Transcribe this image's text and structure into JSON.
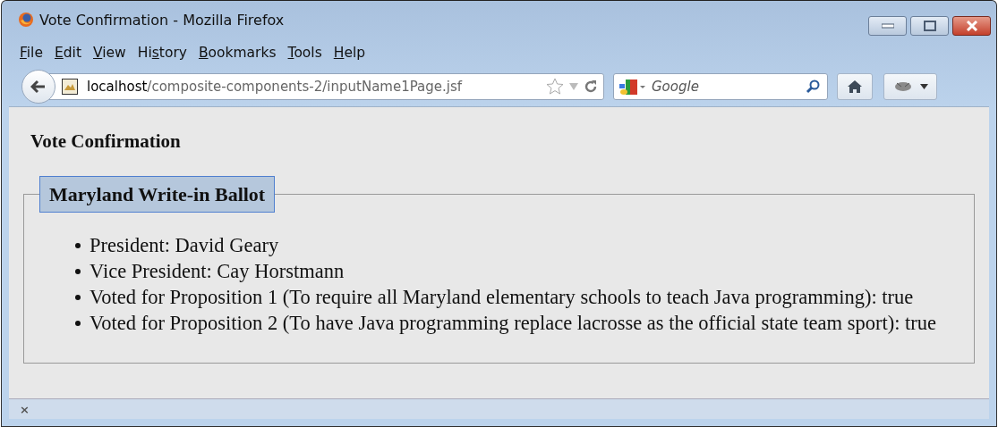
{
  "window": {
    "title": "Vote Confirmation - Mozilla Firefox"
  },
  "menu": [
    {
      "key": "F",
      "after": "ile"
    },
    {
      "key": "E",
      "after": "dit"
    },
    {
      "key": "V",
      "after": "iew"
    },
    {
      "before": "Hi",
      "key": "s",
      "after": "tory"
    },
    {
      "key": "B",
      "after": "ookmarks"
    },
    {
      "key": "T",
      "after": "ools"
    },
    {
      "key": "H",
      "after": "elp"
    }
  ],
  "address": {
    "host": "localhost",
    "path": "/composite-components-2/inputName1Page.jsf"
  },
  "search": {
    "placeholder": "Google"
  },
  "page": {
    "heading": "Vote Confirmation",
    "legend": "Maryland Write-in Ballot",
    "items": [
      "President: David Geary",
      "Vice President: Cay Horstmann",
      "Voted for Proposition 1 (To require all Maryland elementary schools to teach Java programming): true",
      "Voted for Proposition 2 (To have Java programming replace lacrosse as the official state team sport): true"
    ]
  },
  "addon_bar": {
    "close": "×"
  }
}
